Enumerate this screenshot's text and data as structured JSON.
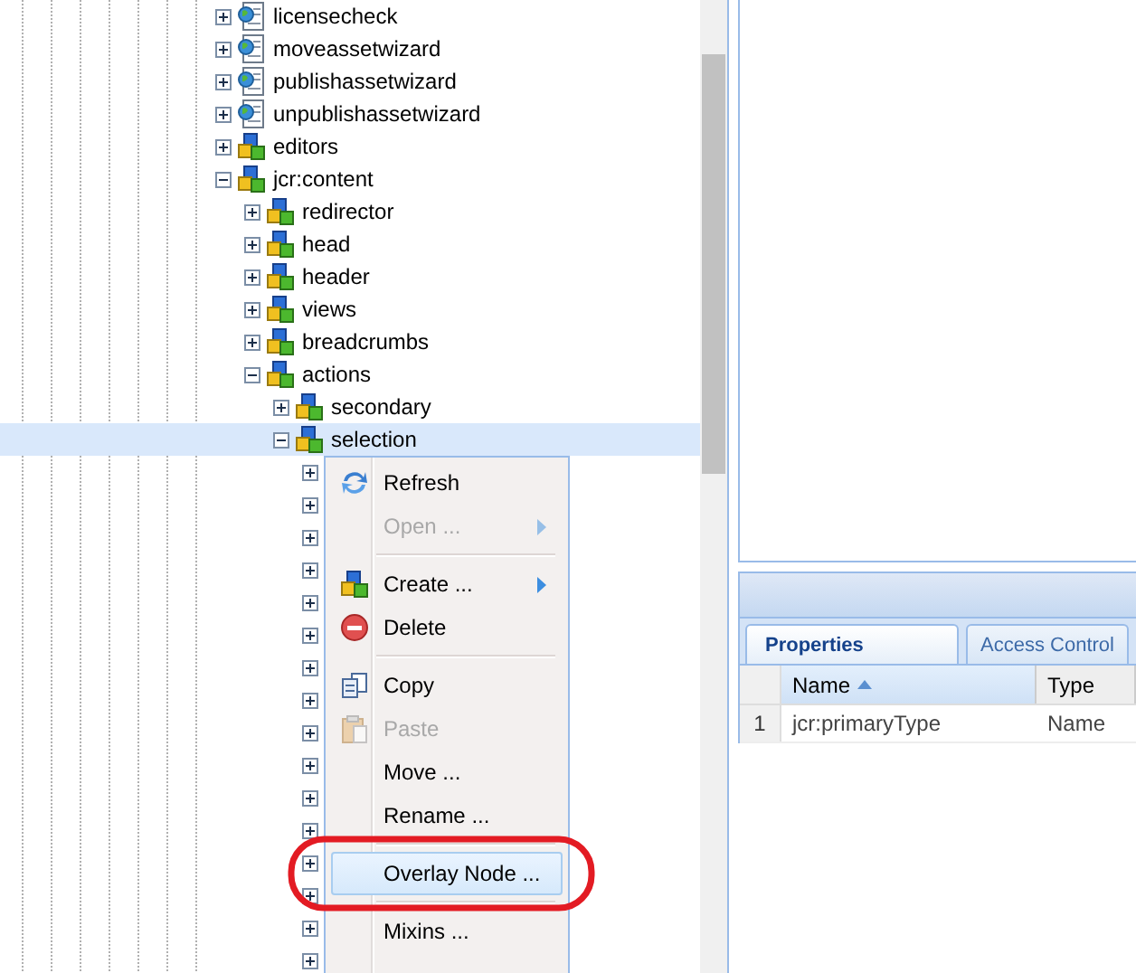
{
  "tree": {
    "items": [
      {
        "label": "licensecheck",
        "kind": "page",
        "expanded": false,
        "selected": false
      },
      {
        "label": "moveassetwizard",
        "kind": "page",
        "expanded": false,
        "selected": false
      },
      {
        "label": "publishassetwizard",
        "kind": "page",
        "expanded": false,
        "selected": false
      },
      {
        "label": "unpublishassetwizard",
        "kind": "page",
        "expanded": false,
        "selected": false
      },
      {
        "label": "editors",
        "kind": "node",
        "expanded": false,
        "selected": false
      },
      {
        "label": "jcr:content",
        "kind": "node",
        "expanded": true,
        "selected": false,
        "children": [
          {
            "label": "redirector",
            "kind": "node",
            "expanded": false,
            "selected": false
          },
          {
            "label": "head",
            "kind": "node",
            "expanded": false,
            "selected": false
          },
          {
            "label": "header",
            "kind": "node",
            "expanded": false,
            "selected": false
          },
          {
            "label": "views",
            "kind": "node",
            "expanded": false,
            "selected": false
          },
          {
            "label": "breadcrumbs",
            "kind": "node",
            "expanded": false,
            "selected": false
          },
          {
            "label": "actions",
            "kind": "node",
            "expanded": true,
            "selected": false,
            "children": [
              {
                "label": "secondary",
                "kind": "node",
                "expanded": false,
                "selected": false
              },
              {
                "label": "selection",
                "kind": "node",
                "expanded": true,
                "selected": true,
                "children": [
                  {
                    "expanded": false,
                    "selected": false
                  },
                  {
                    "expanded": false,
                    "selected": false
                  },
                  {
                    "expanded": false,
                    "selected": false
                  },
                  {
                    "expanded": false,
                    "selected": false
                  },
                  {
                    "expanded": false,
                    "selected": false
                  },
                  {
                    "expanded": false,
                    "selected": false
                  },
                  {
                    "expanded": false,
                    "selected": false
                  },
                  {
                    "expanded": false,
                    "selected": false
                  },
                  {
                    "expanded": false,
                    "selected": false
                  },
                  {
                    "expanded": false,
                    "selected": false
                  },
                  {
                    "expanded": false,
                    "selected": false
                  },
                  {
                    "expanded": false,
                    "selected": false
                  },
                  {
                    "expanded": false,
                    "selected": false
                  },
                  {
                    "expanded": false,
                    "selected": false
                  },
                  {
                    "expanded": false,
                    "selected": false
                  },
                  {
                    "expanded": false,
                    "selected": false
                  }
                ]
              }
            ]
          }
        ]
      }
    ]
  },
  "context_menu": {
    "items": [
      {
        "kind": "refresh",
        "label": "Refresh",
        "disabled": false,
        "submenu": false,
        "selected": false,
        "annotated": false
      },
      {
        "kind": "plain",
        "label": "Open ...",
        "disabled": true,
        "submenu": true,
        "selected": false,
        "annotated": false
      },
      {
        "kind": "separator"
      },
      {
        "kind": "create",
        "label": "Create ...",
        "disabled": false,
        "submenu": true,
        "selected": false,
        "annotated": false
      },
      {
        "kind": "delete",
        "label": "Delete",
        "disabled": false,
        "submenu": false,
        "selected": false,
        "annotated": false
      },
      {
        "kind": "separator"
      },
      {
        "kind": "copy",
        "label": "Copy",
        "disabled": false,
        "submenu": false,
        "selected": false,
        "annotated": false
      },
      {
        "kind": "paste",
        "label": "Paste",
        "disabled": true,
        "submenu": false,
        "selected": false,
        "annotated": false
      },
      {
        "kind": "plain",
        "label": "Move ...",
        "disabled": false,
        "submenu": false,
        "selected": false,
        "annotated": false
      },
      {
        "kind": "plain",
        "label": "Rename ...",
        "disabled": false,
        "submenu": false,
        "selected": false,
        "annotated": false
      },
      {
        "kind": "separator"
      },
      {
        "kind": "plain",
        "label": "Overlay Node ...",
        "disabled": false,
        "submenu": false,
        "selected": true,
        "annotated": true
      },
      {
        "kind": "separator"
      },
      {
        "kind": "plain",
        "label": "Mixins ...",
        "disabled": false,
        "submenu": false,
        "selected": false,
        "annotated": false
      }
    ]
  },
  "properties": {
    "tabs": [
      {
        "label": "Properties",
        "selected": true
      },
      {
        "label": "Access Control",
        "selected": false
      }
    ],
    "columns": [
      {
        "label": "Name",
        "sorted_ascending": true
      },
      {
        "label": "Type",
        "sorted_ascending": false
      }
    ],
    "rows": [
      {
        "number": "1",
        "cells": [
          "jcr:primaryType",
          "Name"
        ]
      }
    ]
  }
}
